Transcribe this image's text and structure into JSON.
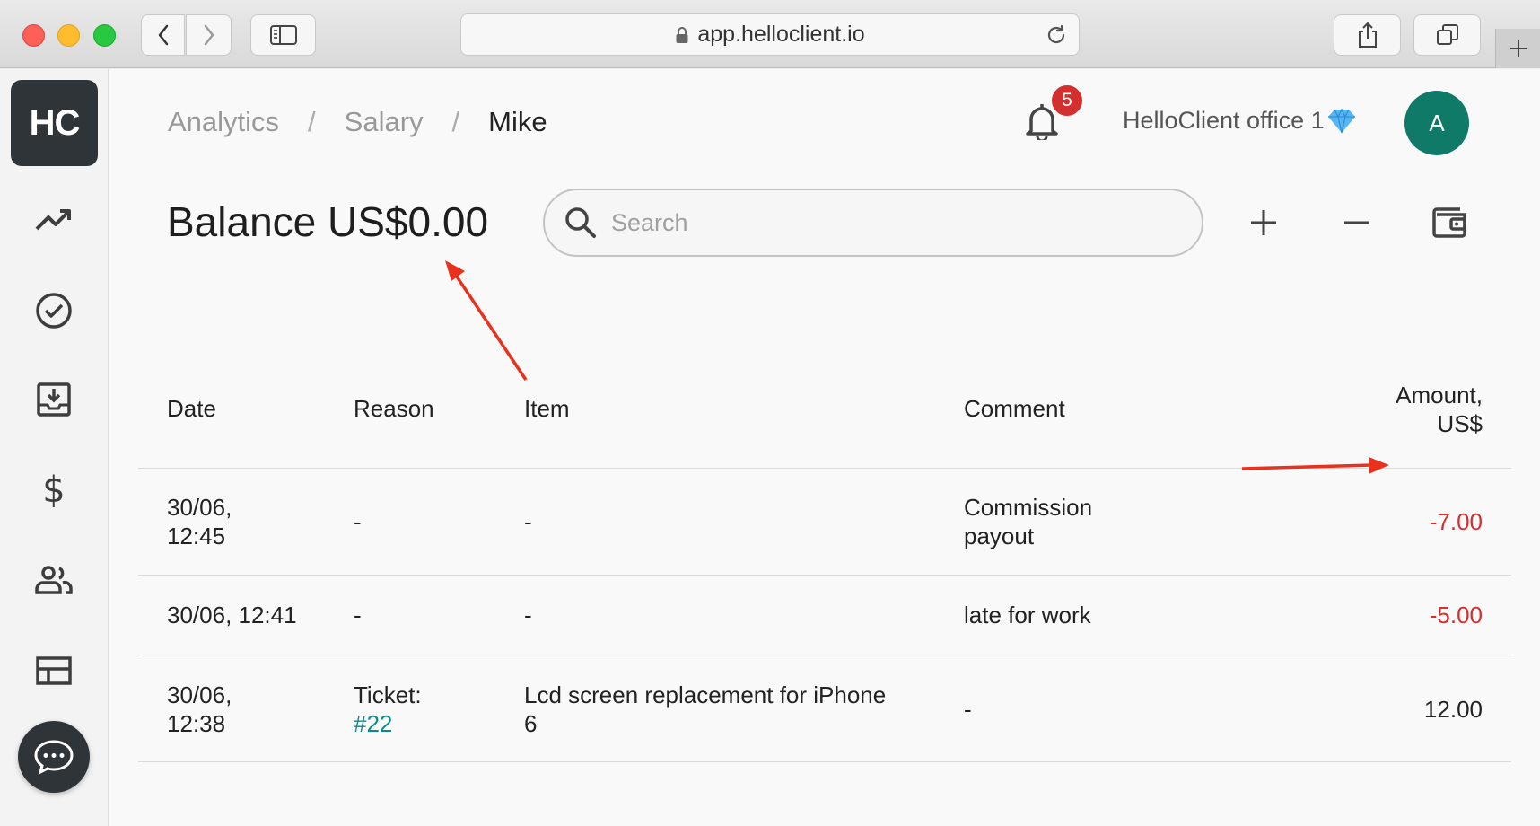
{
  "browser": {
    "url": "app.helloclient.io"
  },
  "sidebar": {
    "logo": "HC",
    "items": [
      {
        "icon": "trending-up-icon"
      },
      {
        "icon": "check-circle-icon"
      },
      {
        "icon": "inbox-download-icon"
      },
      {
        "icon": "dollar-icon"
      },
      {
        "icon": "people-icon"
      },
      {
        "icon": "table-icon"
      }
    ]
  },
  "breadcrumb": {
    "items": [
      "Analytics",
      "Salary",
      "Mike"
    ],
    "separator": "/"
  },
  "header": {
    "notifications_count": "5",
    "office_name": "HelloClient office 1",
    "avatar_letter": "A"
  },
  "balance": {
    "label": "Balance US$0.00"
  },
  "search": {
    "placeholder": "Search"
  },
  "table": {
    "columns": {
      "date": "Date",
      "reason": "Reason",
      "item": "Item",
      "comment": "Comment",
      "amount_line1": "Amount,",
      "amount_line2": "US$"
    },
    "rows": [
      {
        "date_l1": "30/06,",
        "date_l2": "12:45",
        "reason": "-",
        "item": "-",
        "comment_l1": "Commission",
        "comment_l2": "payout",
        "amount": "-7.00"
      },
      {
        "date": "30/06, 12:41",
        "reason": "-",
        "item": "-",
        "comment": "late for work",
        "amount": "-5.00"
      },
      {
        "date_l1": "30/06,",
        "date_l2": "12:38",
        "reason_l1": "Ticket:",
        "reason_link": "#22",
        "item_l1": "Lcd screen replacement for iPhone",
        "item_l2": "6",
        "comment": "-",
        "amount": "12.00"
      }
    ]
  },
  "colors": {
    "negative": "#d32f2f",
    "link": "#0e8a8f",
    "avatar": "#0e7a67",
    "annotation_arrow": "#e8321e"
  }
}
